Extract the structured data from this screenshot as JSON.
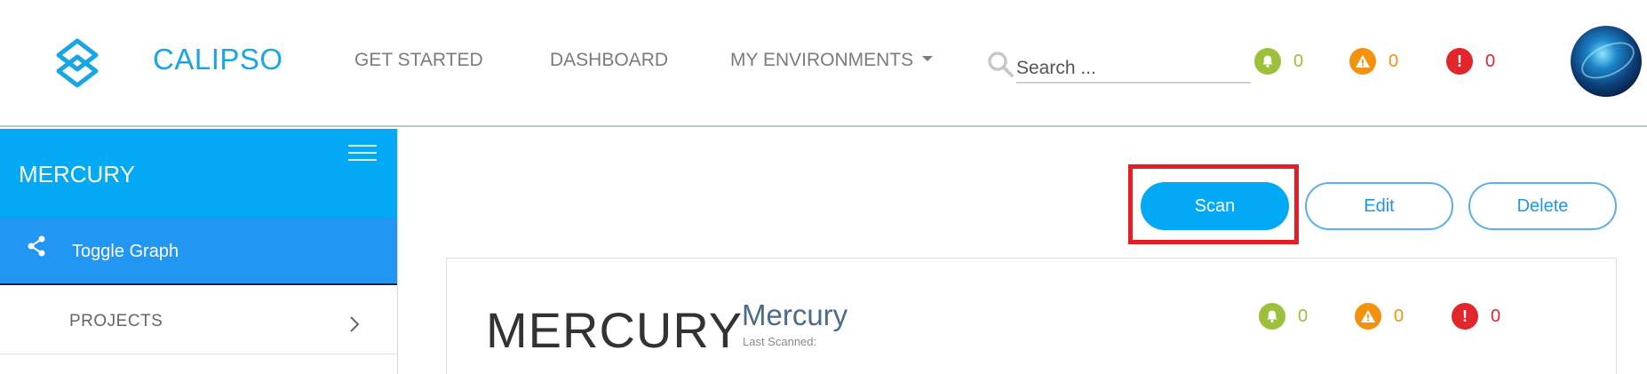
{
  "header": {
    "brand": "CALIPSO",
    "nav": {
      "get_started": "GET STARTED",
      "dashboard": "DASHBOARD",
      "my_environments": "MY ENVIRONMENTS"
    },
    "search": {
      "placeholder": "Search ...",
      "value": ""
    },
    "counters": [
      {
        "type": "info",
        "glyph": "bell",
        "count": "0",
        "color": "#9cc03a"
      },
      {
        "type": "warning",
        "glyph": "!",
        "count": "0",
        "color": "#f2920f"
      },
      {
        "type": "error",
        "glyph": "!",
        "count": "0",
        "color": "#e3262c"
      }
    ]
  },
  "sidebar": {
    "title": "MERCURY",
    "toggle_graph": "Toggle Graph",
    "projects": "PROJECTS"
  },
  "actions": {
    "scan": "Scan",
    "edit": "Edit",
    "delete": "Delete"
  },
  "environment": {
    "name": "MERCURY",
    "subtitle": "Mercury",
    "last_scanned": "Last Scanned:",
    "counters": [
      {
        "type": "info",
        "count": "0"
      },
      {
        "type": "warning",
        "count": "0"
      },
      {
        "type": "error",
        "count": "0"
      }
    ]
  },
  "colors": {
    "accent": "#03a9f4",
    "sidebar_active": "#2196f3",
    "info": "#9cc03a",
    "warning": "#f2920f",
    "error": "#e3262c",
    "highlight": "#e31e24"
  }
}
